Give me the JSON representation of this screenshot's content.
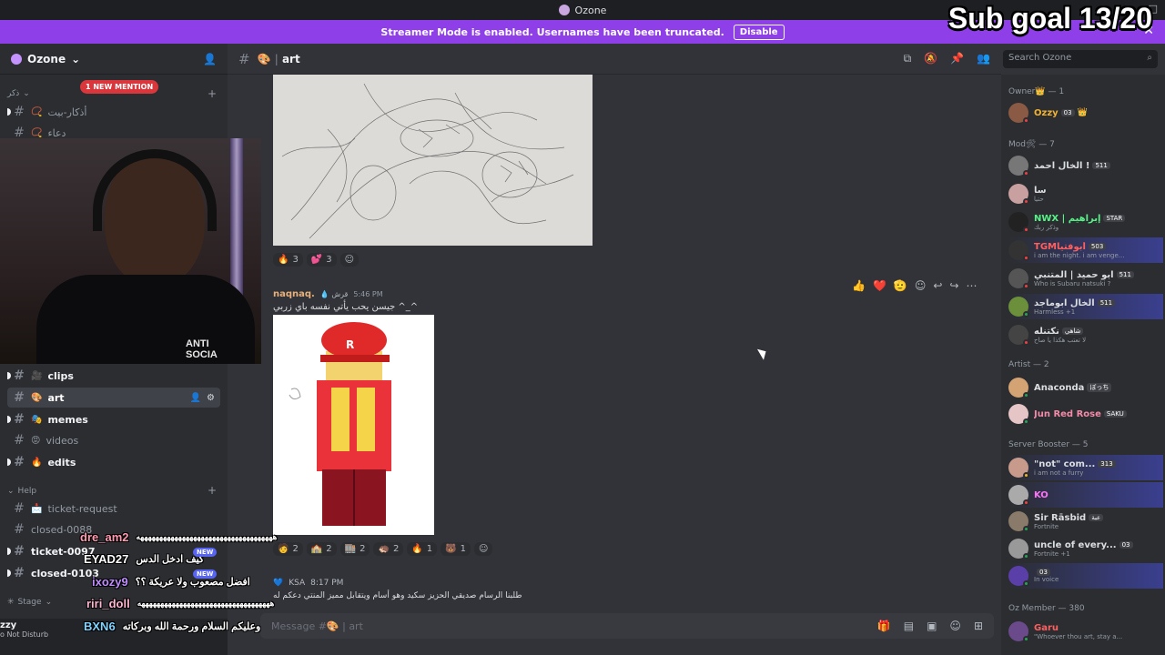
{
  "window": {
    "title": "Ozone"
  },
  "overlay": {
    "sub_goal": "Sub goal 13/20"
  },
  "banner": {
    "text": "Streamer Mode is enabled. Usernames have been truncated.",
    "button": "Disable"
  },
  "server": {
    "name": "Ozone",
    "mention_pill": "1 NEW MENTION"
  },
  "sidebar": {
    "category_top": "ذكر",
    "channels_top": [
      {
        "name": "أذكار-بيت",
        "emoji": "📿",
        "bold": false
      },
      {
        "name": "دعاء",
        "emoji": "📿",
        "bold": false
      }
    ],
    "channels_mid": [
      {
        "name": "clips",
        "emoji": "🎥",
        "bold": true,
        "active": false
      },
      {
        "name": "art",
        "emoji": "🎨",
        "bold": true,
        "active": true
      },
      {
        "name": "memes",
        "emoji": "🎭",
        "bold": true,
        "active": false
      },
      {
        "name": "videos",
        "emoji": "😡",
        "bold": false,
        "active": false
      },
      {
        "name": "edits",
        "emoji": "🔥",
        "bold": true,
        "active": false
      }
    ],
    "category_help": "Help",
    "channels_help": [
      {
        "name": "ticket-request",
        "emoji": "📩",
        "bold": false
      },
      {
        "name": "closed-0088",
        "emoji": "",
        "bold": false
      },
      {
        "name": "ticket-0097",
        "emoji": "",
        "bold": true
      },
      {
        "name": "closed-0103",
        "emoji": "",
        "bold": true
      }
    ],
    "category_stage": "Stage",
    "user_name": "zzy",
    "user_status": "o Not Disturb"
  },
  "webcam": {
    "hoodie_text": "ANTI\nSOCIA"
  },
  "channel": {
    "name": "art",
    "emoji": "🎨",
    "search_placeholder": "Search Ozone",
    "input_placeholder": "Message #🎨 | art"
  },
  "messages": {
    "first_reactions": [
      {
        "emoji": "🔥",
        "count": "3"
      },
      {
        "emoji": "💕",
        "count": "3"
      }
    ],
    "author": "naqnaq.",
    "author_tag": "قرش",
    "time": "5:46 PM",
    "text": "جيسن يحب يأتي نفسه باي زربي ^_^",
    "second_reactions": [
      {
        "emoji": "🧑",
        "count": "2"
      },
      {
        "emoji": "🏫",
        "count": "2"
      },
      {
        "emoji": "🏬",
        "count": "2"
      },
      {
        "emoji": "🦔",
        "count": "2"
      },
      {
        "emoji": "🔥",
        "count": "1"
      },
      {
        "emoji": "🐻",
        "count": "1"
      }
    ],
    "bottom_author_tag": "KSA",
    "bottom_time": "8:17 PM",
    "bottom_text": "طلبنا الرسام صديقي الحزيز سكيد وهو أسام ويتقابل مميز المنتي دعكم له"
  },
  "chat_overlay": [
    {
      "user": "dre_am2",
      "color": "#ff9ab0",
      "text": "ههههههههههههههههههههههههههههههههههههه"
    },
    {
      "user": "EYAD27",
      "color": "#ffffff",
      "text": "كيف ادخل الدس"
    },
    {
      "user": "ixozy9",
      "color": "#c08cff",
      "text": "افضل مصعوب ولا عريكة ؟؟"
    },
    {
      "user": "riri_doll",
      "color": "#ffb6d1",
      "text": "هههههههههههههههههههههههههههههههههههه"
    },
    {
      "user": "BXN6",
      "color": "#7fd3ff",
      "text": "وعليكم السلام ورحمة الله وبركاته"
    }
  ],
  "new_badge": "NEW",
  "members": {
    "roles": [
      {
        "label": "Owner👑 — 1"
      },
      {
        "label": "Mod🛠 — 7"
      },
      {
        "label": "Artist — 2"
      },
      {
        "label": "Server Booster — 5"
      },
      {
        "label": "Oz Member — 380"
      }
    ],
    "list": [
      {
        "name": "Ozzy",
        "badge": "03",
        "sub": "",
        "color": "#f0b232",
        "avatar": "#8a5a44",
        "status": "#f23f43"
      },
      {
        "name": "الخال احمد !",
        "badge": "511",
        "sub": "",
        "color": "#f0f0f0",
        "avatar": "#777",
        "status": "#f23f43"
      },
      {
        "name": "سا",
        "badge": "",
        "sub": "حتيا",
        "color": "#f0f0f0",
        "avatar": "#c9a0a0",
        "status": "#f23f43"
      },
      {
        "name": "NWX | إبراهيم",
        "badge": "STAR",
        "sub": "وذكر ربك",
        "color": "#57f287",
        "avatar": "#222",
        "status": "#f23f43"
      },
      {
        "name": "TGMأبوفتيا",
        "badge": "503",
        "sub": "i am the night. i am venge...",
        "color": "#ff5f5f",
        "avatar": "#333",
        "status": "#f23f43"
      },
      {
        "name": "ابو حميد | المتنبي",
        "badge": "511",
        "sub": "Who is Subaru natsuki ?",
        "color": "#f0f0f0",
        "avatar": "#555",
        "status": "#f23f43"
      },
      {
        "name": "الخال ابوماجد",
        "badge": "511",
        "sub": "Harmless +1",
        "color": "#f0f0f0",
        "avatar": "#6b8f3a",
        "status": "#23a55a"
      },
      {
        "name": "نكتنله",
        "badge": "شاهي",
        "sub": "لا تعتب هكذا يا صاح",
        "color": "#f0f0f0",
        "avatar": "#444",
        "status": "#f23f43"
      },
      {
        "name": "Anaconda",
        "badge": "ぼっち",
        "sub": "",
        "color": "#f0f0f0",
        "avatar": "#d4a373",
        "status": "#23a55a"
      },
      {
        "name": "Jun Red Rose",
        "badge": "SAKU",
        "sub": "",
        "color": "#f38ba8",
        "avatar": "#e5c5c5",
        "status": "#23a55a"
      },
      {
        "name": "\"not\" com...",
        "badge": "313",
        "sub": "i am not a furry",
        "color": "#f0f0f0",
        "avatar": "#c79a8c",
        "status": "#f0b232"
      },
      {
        "name": "KO",
        "badge": "",
        "sub": "",
        "color": "#ff73fa",
        "avatar": "#aaa",
        "status": "#f23f43"
      },
      {
        "name": "Sir Rāsbid",
        "badge": "عبة",
        "sub": "Fortnite",
        "color": "#f0f0f0",
        "avatar": "#8a7a6a",
        "status": "#23a55a"
      },
      {
        "name": "uncle of every...",
        "badge": "03",
        "sub": "Fortnite +1",
        "color": "#f0f0f0",
        "avatar": "#999",
        "status": "#23a55a"
      },
      {
        "name": "",
        "badge": "03",
        "sub": "In voice",
        "color": "#f0f0f0",
        "avatar": "#5b3fa8",
        "status": "#23a55a"
      },
      {
        "name": "Garu",
        "badge": "",
        "sub": "\"Whoever thou art, stay a...",
        "color": "#ff5f5f",
        "avatar": "#6a4a8a",
        "status": "#23a55a"
      }
    ]
  }
}
